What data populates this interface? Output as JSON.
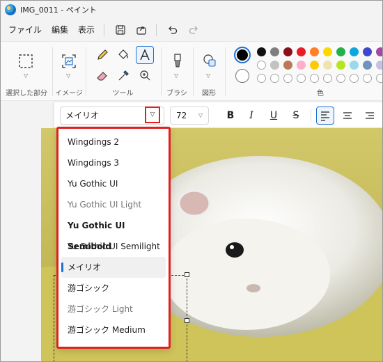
{
  "window": {
    "title": "IMG_0011 - ペイント"
  },
  "menubar": {
    "items": [
      "ファイル",
      "編集",
      "表示"
    ]
  },
  "ribbon": {
    "groups": {
      "selection": "選択した部分",
      "image": "イメージ",
      "tools": "ツール",
      "brushes": "ブラシ",
      "shapes": "図形",
      "colors": "色"
    },
    "palette_colors": [
      "#111111",
      "#7f7f7f",
      "#8b0f1a",
      "#e81d25",
      "#ff7f26",
      "#ffd700",
      "#23b14c",
      "#0fa6e0",
      "#3f48cc",
      "#a349a4",
      "#ffffff",
      "#c3c3c3",
      "#b97a57",
      "#ffaec9",
      "#ffc90e",
      "#efe4b0",
      "#b5e61d",
      "#99d9ea",
      "#7092be",
      "#c8bfe7"
    ],
    "primary_color": "#000000",
    "secondary_color": "#ffffff"
  },
  "texttoolbar": {
    "font": "メイリオ",
    "size": "72",
    "bold": "B",
    "italic": "I",
    "underline": "U",
    "strike": "S"
  },
  "font_list": [
    {
      "label": "Wingdings 2",
      "style": "normal"
    },
    {
      "label": "Wingdings 3",
      "style": "normal"
    },
    {
      "label": "Yu Gothic UI",
      "style": "normal"
    },
    {
      "label": "Yu Gothic UI Light",
      "style": "light"
    },
    {
      "label": "Yu Gothic UI Semibold",
      "style": "bold"
    },
    {
      "label": "Yu Gothic UI Semilight",
      "style": "normal"
    },
    {
      "label": "メイリオ",
      "style": "selected"
    },
    {
      "label": "游ゴシック",
      "style": "normal"
    },
    {
      "label": "游ゴシック Light",
      "style": "light"
    },
    {
      "label": "游ゴシック Medium",
      "style": "normal"
    }
  ],
  "canvas_image": {
    "subject": "hamster"
  }
}
